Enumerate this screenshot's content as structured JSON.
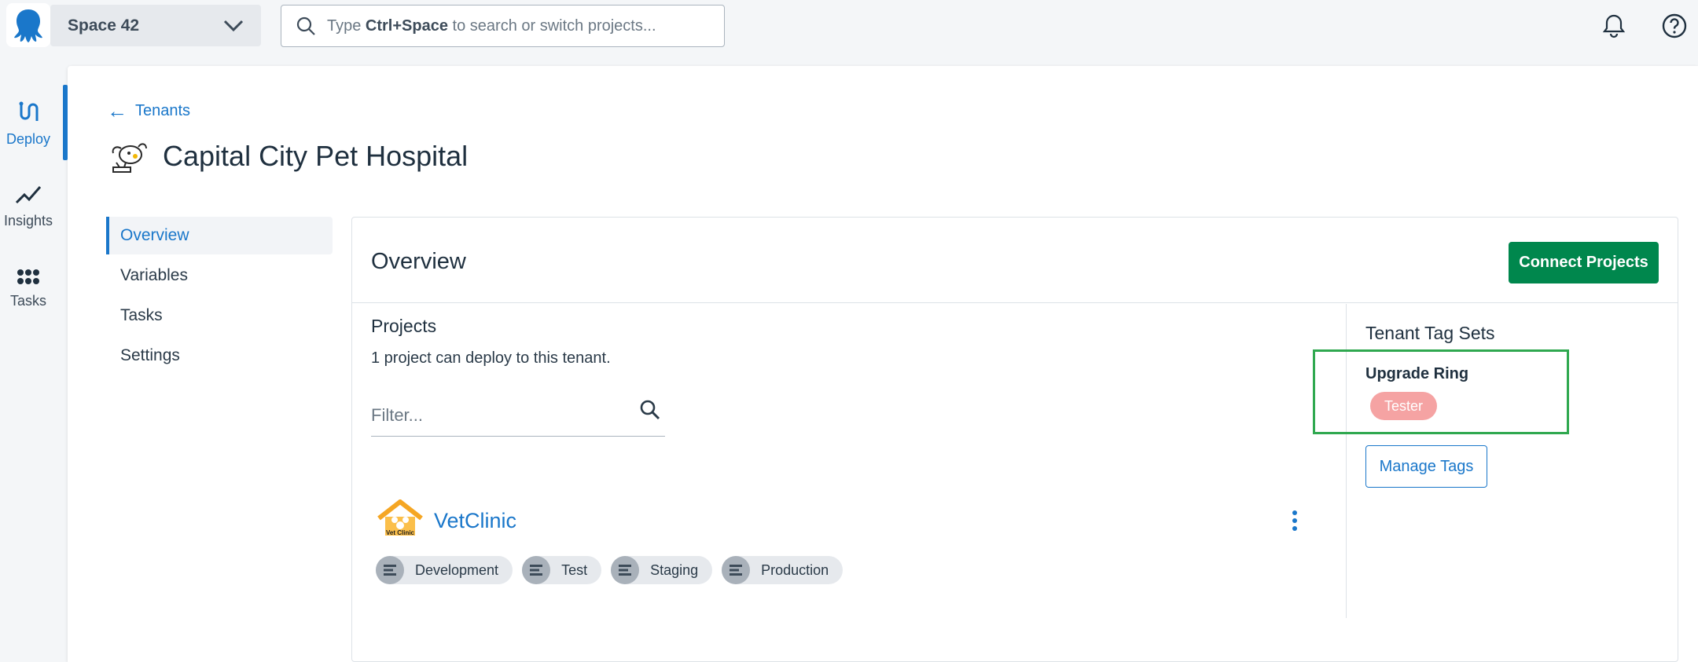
{
  "topbar": {
    "space_name": "Space 42",
    "search_placeholder_prefix": "Type",
    "search_placeholder_key": "Ctrl+Space",
    "search_placeholder_suffix": "to search or switch projects..."
  },
  "rail": {
    "items": [
      {
        "label": "Deploy",
        "icon": "deploy-icon",
        "active": true
      },
      {
        "label": "Insights",
        "icon": "insights-icon",
        "active": false
      },
      {
        "label": "Tasks",
        "icon": "tasks-icon",
        "active": false
      }
    ]
  },
  "page": {
    "back_label": "Tenants",
    "title": "Capital City Pet Hospital"
  },
  "sidenav": {
    "items": [
      "Overview",
      "Variables",
      "Tasks",
      "Settings"
    ],
    "active": "Overview"
  },
  "overview": {
    "title": "Overview",
    "connect_label": "Connect Projects",
    "projects_heading": "Projects",
    "projects_desc": "1 project can deploy to this tenant.",
    "filter_placeholder": "Filter...",
    "project": {
      "name": "VetClinic",
      "logo_text": "Vet Clinic",
      "environments": [
        "Development",
        "Test",
        "Staging",
        "Production"
      ]
    }
  },
  "tagsets": {
    "heading": "Tenant Tag Sets",
    "set_name": "Upgrade Ring",
    "tag": "Tester",
    "manage_label": "Manage Tags"
  },
  "colors": {
    "accent": "#1a77ca",
    "primary_button": "#00874d",
    "tag_pill": "#f5a3a3",
    "highlight_box": "#2fa84f"
  }
}
